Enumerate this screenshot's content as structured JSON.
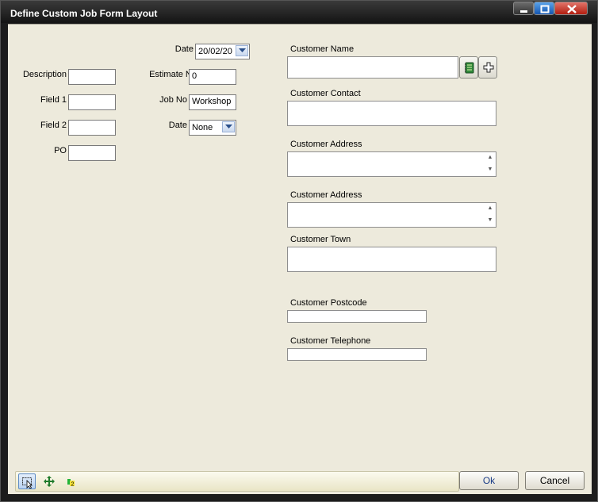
{
  "window": {
    "title": "Define Custom Job Form Layout"
  },
  "left": {
    "description_label": "Description",
    "field1_label": "Field 1",
    "field2_label": "Field 2",
    "po_label": "PO"
  },
  "middle": {
    "date_label": "Date",
    "date_value": "20/02/20",
    "estimate_label": "Estimate No",
    "estimate_value": "0",
    "jobno_label": "Job No",
    "jobno_value": "Workshop",
    "date2_label": "Date",
    "date2_value": "None"
  },
  "right": {
    "customer_name_label": "Customer Name",
    "customer_contact_label": "Customer Contact",
    "customer_address1_label": "Customer Address",
    "customer_address2_label": "Customer Address",
    "customer_town_label": "Customer Town",
    "customer_postcode_label": "Customer Postcode",
    "customer_telephone_label": "Customer Telephone"
  },
  "toolbar": {
    "tools": [
      "select-tool-icon",
      "move-tool-icon",
      "tab-order-tool-icon"
    ],
    "tab_order_badge": "2"
  },
  "buttons": {
    "ok_label": "Ok",
    "cancel_label": "Cancel"
  },
  "colors": {
    "window_chrome": "#1c1c1c",
    "client_background": "#edeadc",
    "close_button": "#c7372a",
    "maximize_button": "#2a6fd0"
  }
}
